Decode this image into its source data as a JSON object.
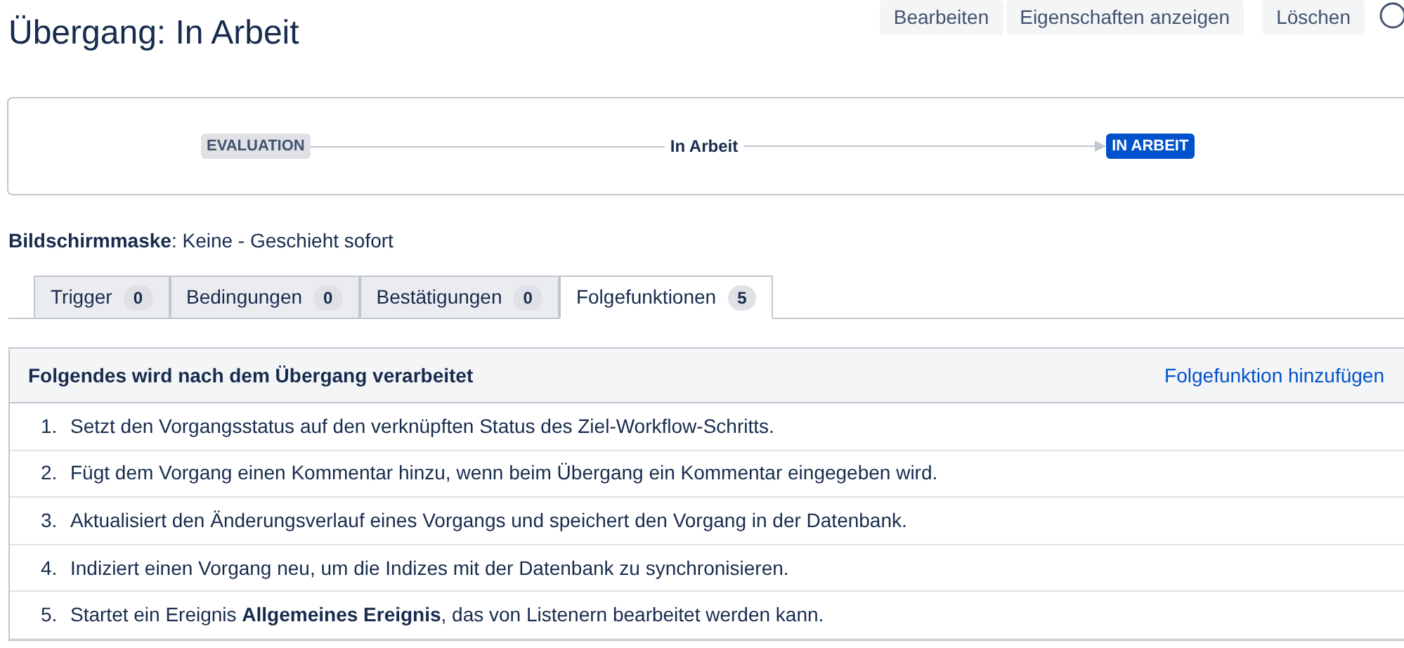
{
  "title": "Übergang: In Arbeit",
  "actions": [
    {
      "label": "Bearbeiten"
    },
    {
      "label": "Eigenschaften anzeigen"
    },
    {
      "label": "Löschen"
    }
  ],
  "diagram": {
    "from": "EVALUATION",
    "transition": "In Arbeit",
    "to": "IN ARBEIT"
  },
  "screen": {
    "label": "Bildschirmmaske",
    "value": ": Keine - Geschieht sofort"
  },
  "tabs": [
    {
      "label": "Trigger",
      "count": "0",
      "selected": false
    },
    {
      "label": "Bedingungen",
      "count": "0",
      "selected": false
    },
    {
      "label": "Bestätigungen",
      "count": "0",
      "selected": false
    },
    {
      "label": "Folgefunktionen",
      "count": "5",
      "selected": true
    }
  ],
  "panel": {
    "heading": "Folgendes wird nach dem Übergang verarbeitet",
    "add_link": "Folgefunktion hinzufügen",
    "items": [
      {
        "number": "1.",
        "text": "Setzt den Vorgangsstatus auf den verknüpften Status des Ziel-Workflow-Schritts."
      },
      {
        "number": "2.",
        "text": "Fügt dem Vorgang einen Kommentar hinzu, wenn beim Übergang ein Kommentar eingegeben wird."
      },
      {
        "number": "3.",
        "text": "Aktualisiert den Änderungsverlauf eines Vorgangs und speichert den Vorgang in der Datenbank."
      },
      {
        "number": "4.",
        "text": "Indiziert einen Vorgang neu, um die Indizes mit der Datenbank zu synchronisieren."
      },
      {
        "number": "5.",
        "text": "Startet ein Ereignis **Allgemeines Ereignis**, das von Listenern bearbeitet werden kann."
      }
    ]
  }
}
